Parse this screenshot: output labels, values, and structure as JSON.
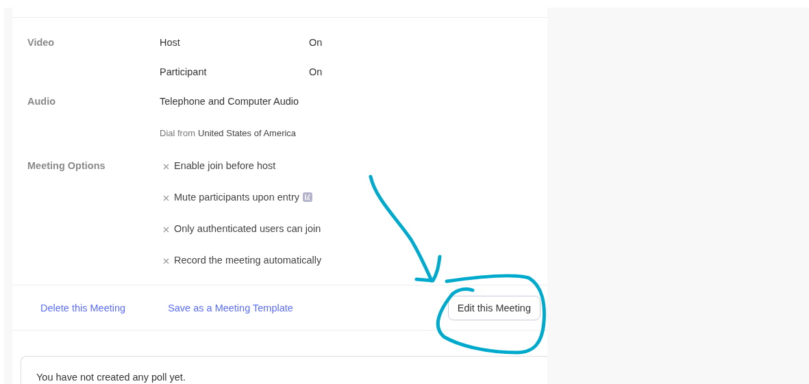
{
  "details": [
    {
      "label": "Video",
      "items": [
        {
          "kind": "pair",
          "name": "Host",
          "value": "On"
        },
        {
          "kind": "pair",
          "name": "Participant",
          "value": "On"
        }
      ]
    },
    {
      "label": "Audio",
      "items": [
        {
          "kind": "text",
          "text": "Telephone and Computer Audio"
        },
        {
          "kind": "dial",
          "prefix": "Dial from",
          "country": "United States of America"
        }
      ]
    },
    {
      "label": "Meeting Options",
      "items": [
        {
          "kind": "option",
          "text": "Enable join before host",
          "checked": false,
          "info_badge": false
        },
        {
          "kind": "option",
          "text": "Mute participants upon entry",
          "checked": false,
          "info_badge": true
        },
        {
          "kind": "option",
          "text": "Only authenticated users can join",
          "checked": false,
          "info_badge": false
        },
        {
          "kind": "option",
          "text": "Record the meeting automatically",
          "checked": false,
          "info_badge": false
        }
      ]
    }
  ],
  "actions": {
    "links": [
      "Delete this Meeting",
      "Save as a Meeting Template"
    ],
    "button": "Edit this Meeting"
  },
  "poll": {
    "message": "You have not created any poll yet."
  }
}
